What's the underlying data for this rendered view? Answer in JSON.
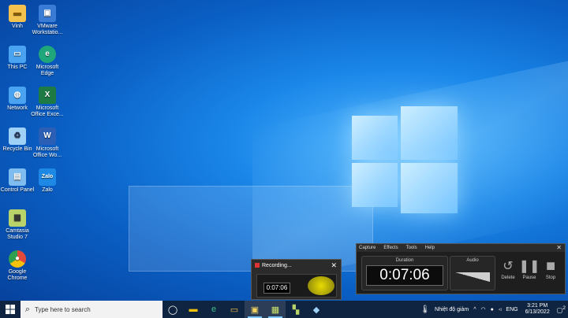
{
  "desktop_icons": [
    {
      "label": "Vinh",
      "glyph": "folder-icon",
      "color": "#f2c14e"
    },
    {
      "label": "VMware Workstatio...",
      "glyph": "vmware-icon",
      "color": "#3a7bd5"
    },
    {
      "label": "This PC",
      "glyph": "computer-icon",
      "color": "#4aa3f0"
    },
    {
      "label": "Microsoft Edge",
      "glyph": "edge-icon",
      "color": "#1fa67a"
    },
    {
      "label": "Network",
      "glyph": "network-icon",
      "color": "#4aa3f0"
    },
    {
      "label": "Microsoft Office Exce...",
      "glyph": "excel-icon",
      "color": "#1e7a45"
    },
    {
      "label": "Recycle Bin",
      "glyph": "recycle-bin-icon",
      "color": "#9fd0f5"
    },
    {
      "label": "Microsoft Office Wo...",
      "glyph": "word-icon",
      "color": "#2b5fb5"
    },
    {
      "label": "Control Panel",
      "glyph": "control-panel-icon",
      "color": "#7fbdf0"
    },
    {
      "label": "Zalo",
      "glyph": "zalo-icon",
      "color": "#1e88e5"
    },
    {
      "label": "Camtasia Studio 7",
      "glyph": "camtasia-icon",
      "color": "#b7d36a"
    },
    {
      "label": "Google Chrome",
      "glyph": "chrome-icon",
      "color": "#e14a3b"
    }
  ],
  "taskbar": {
    "search_placeholder": "Type here to search",
    "weather": "Nhiệt độ giảm",
    "lang": "ENG",
    "time": "3:21 PM",
    "date": "6/13/2022",
    "notif_count": "2"
  },
  "recorder": {
    "menu": [
      "Capture",
      "Effects",
      "Tools",
      "Help"
    ],
    "duration_label": "Duration",
    "duration": "0:07:06",
    "audio_label": "Audio",
    "delete_label": "Delete",
    "pause_label": "Pause",
    "stop_label": "Stop"
  },
  "recording_popup": {
    "title": "Recording...",
    "thumb_time": "0:07:06"
  }
}
